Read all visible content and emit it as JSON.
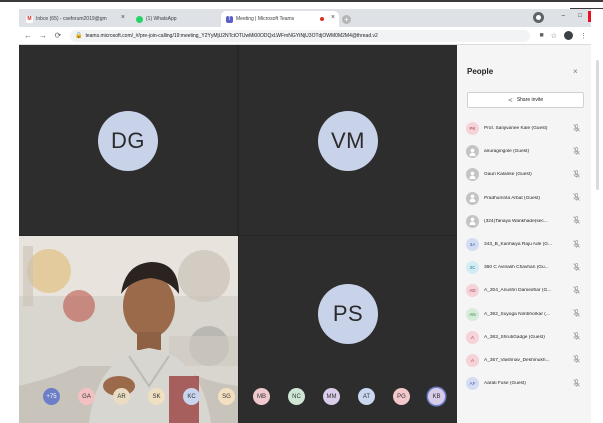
{
  "browser": {
    "tabs": [
      {
        "title": "Inbox (65) - cseforum2019@gm",
        "icon": "gmail-icon",
        "color": "#d93025"
      },
      {
        "title": "(1) WhatsApp",
        "icon": "whatsapp-icon",
        "color": "#25d366"
      },
      {
        "title": "Meeting | Microsoft Teams",
        "icon": "teams-icon",
        "color": "#5b5fc7"
      }
    ],
    "new_tab": "+",
    "url": "teams.microsoft.com/_#/pre-join-calling/19:meeting_Y2YyMjU2NTctOTUwMi00ODQxLWFmNGYtNjU3OTdjOWM0M2M4@thread.v2"
  },
  "meeting": {
    "tiles": [
      {
        "initials": "DG"
      },
      {
        "initials": "VM"
      },
      {
        "initials": "PS"
      }
    ],
    "overflow_count": "+75",
    "participant_chips": [
      {
        "initials": "GA",
        "color": "#f3c1c1"
      },
      {
        "initials": "AR",
        "color": "#e9dcc2"
      },
      {
        "initials": "SK",
        "color": "#f0dfc1"
      },
      {
        "initials": "KC",
        "color": "#c9d5ef"
      },
      {
        "initials": "SG",
        "color": "#f3e0c0"
      },
      {
        "initials": "MB",
        "color": "#f0c9cf"
      },
      {
        "initials": "NC",
        "color": "#cfe6d4"
      },
      {
        "initials": "MM",
        "color": "#d9cdea"
      },
      {
        "initials": "AT",
        "color": "#c9d8ee"
      },
      {
        "initials": "PG",
        "color": "#f2c8cc"
      },
      {
        "initials": "KB",
        "color": "#d8cde8"
      }
    ],
    "overflow_color": "#6c7ec7"
  },
  "people_panel": {
    "title": "People",
    "close": "×",
    "share_label": "Share invite",
    "participants": [
      {
        "initials": "PK",
        "name": "Prof. Sanjivanee Kale (Guest)",
        "color": "#f5d3d8",
        "fg": "#a33a4f"
      },
      {
        "initials": "",
        "name": "anuragingole (Guest)",
        "color": "#c4c4c4",
        "fg": "#ffffff"
      },
      {
        "initials": "",
        "name": "Gauri Kalanke (Guest)",
        "color": "#c4c4c4",
        "fg": "#ffffff"
      },
      {
        "initials": "",
        "name": "Pradhumnta Arbat (Guest)",
        "color": "#c4c4c4",
        "fg": "#ffffff"
      },
      {
        "initials": "",
        "name": "(324)Tanaya Wankhade(sec...",
        "color": "#c4c4c4",
        "fg": "#ffffff"
      },
      {
        "initials": "3A",
        "name": "343_B_Kanhaiya Raju Ade (G...",
        "color": "#d3dcf3",
        "fg": "#3d5aa6"
      },
      {
        "initials": "3C",
        "name": "360 C Avinash Chavhan (Gu...",
        "color": "#d4ecf3",
        "fg": "#2b7d97"
      },
      {
        "initials": "AD",
        "name": "A_304_Anushri Damedhar (G...",
        "color": "#f5d3d8",
        "fg": "#a33a4f"
      },
      {
        "initials": "AN",
        "name": "A_362_Suyoga Nimbhorkar (...",
        "color": "#d5ecd8",
        "fg": "#3a7d48"
      },
      {
        "initials": "A",
        "name": "A_363_ShrutiGadge (Guest)",
        "color": "#f5d3d8",
        "fg": "#a33a4f"
      },
      {
        "initials": "A",
        "name": "A_367_Vaishnav_Deshmukh...",
        "color": "#f5d3d8",
        "fg": "#a33a4f"
      },
      {
        "initials": "AF",
        "name": "Aarati Fuse (Guest)",
        "color": "#d3dcf3",
        "fg": "#3d5aa6"
      }
    ]
  }
}
